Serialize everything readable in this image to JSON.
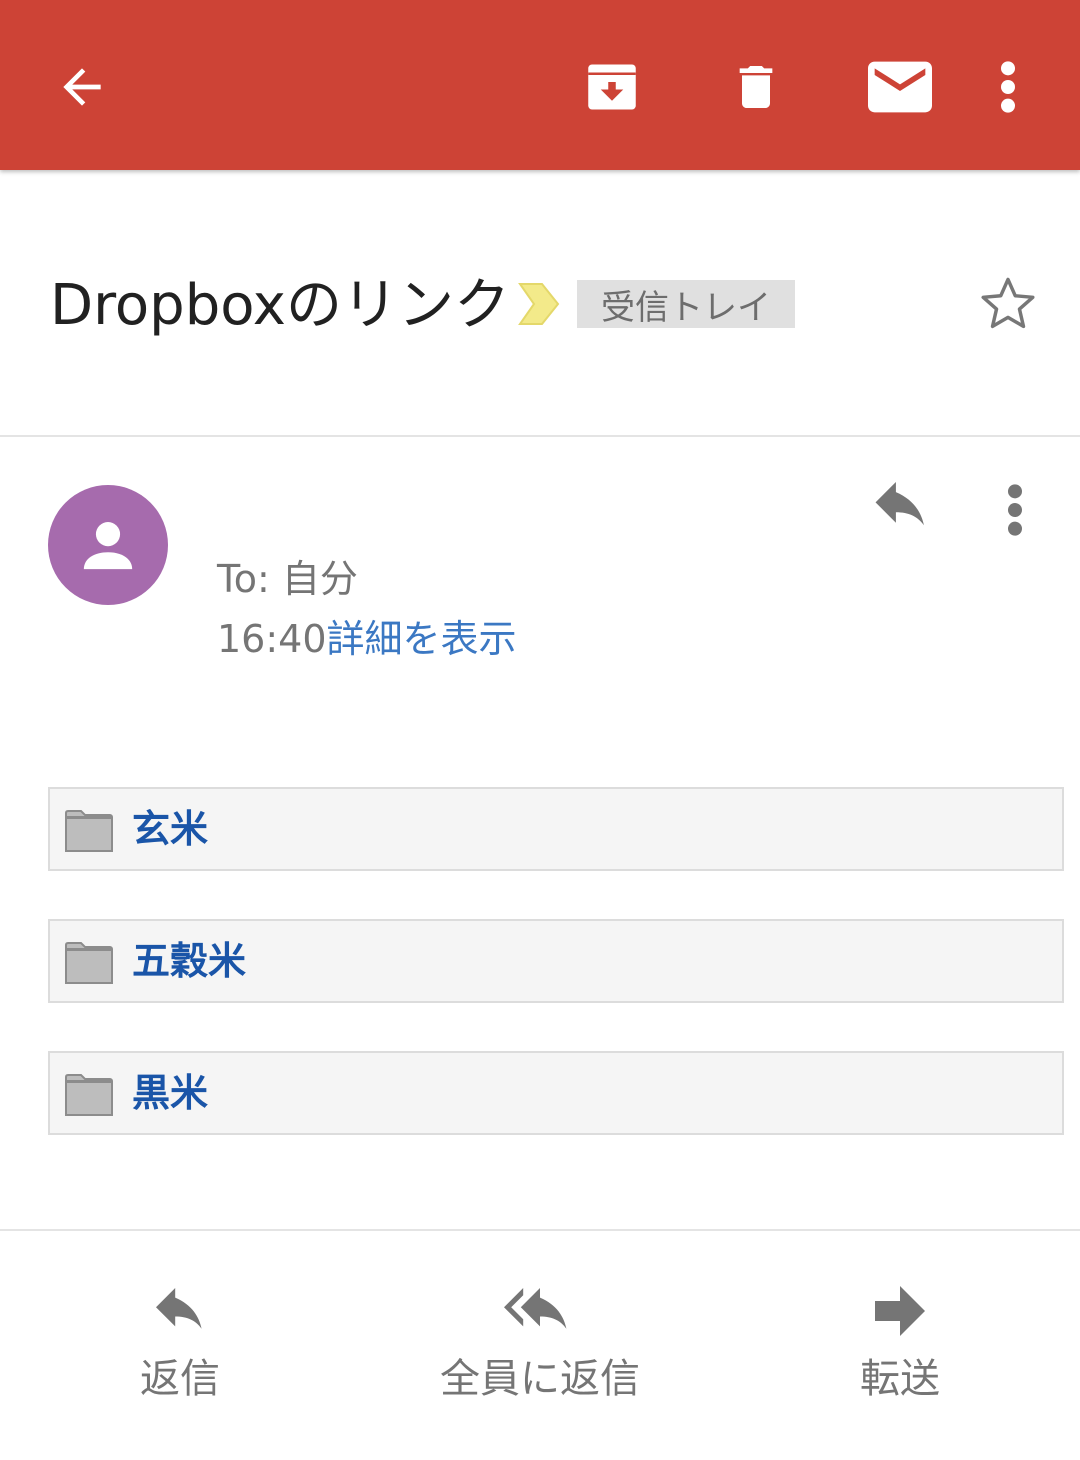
{
  "colors": {
    "appbar": "#cd4336",
    "avatar": "#a66bad",
    "link": "#3b78c3",
    "attachment_text": "#1a55a8",
    "important_marker": "#f3ea8a"
  },
  "toolbar": {
    "back_icon": "arrow-left-icon",
    "archive_icon": "archive-icon",
    "delete_icon": "trash-icon",
    "mark_unread_icon": "mail-icon",
    "more_icon": "more-vert-icon"
  },
  "subject": {
    "title": "Dropboxのリンク",
    "label": "受信トレイ"
  },
  "message": {
    "to": "To: 自分",
    "time": "16:40",
    "details_link": "詳細を表示"
  },
  "attachments": [
    {
      "name": "玄米"
    },
    {
      "name": "五穀米"
    },
    {
      "name": "黒米"
    }
  ],
  "actions": {
    "reply": "返信",
    "reply_all": "全員に返信",
    "forward": "転送"
  }
}
